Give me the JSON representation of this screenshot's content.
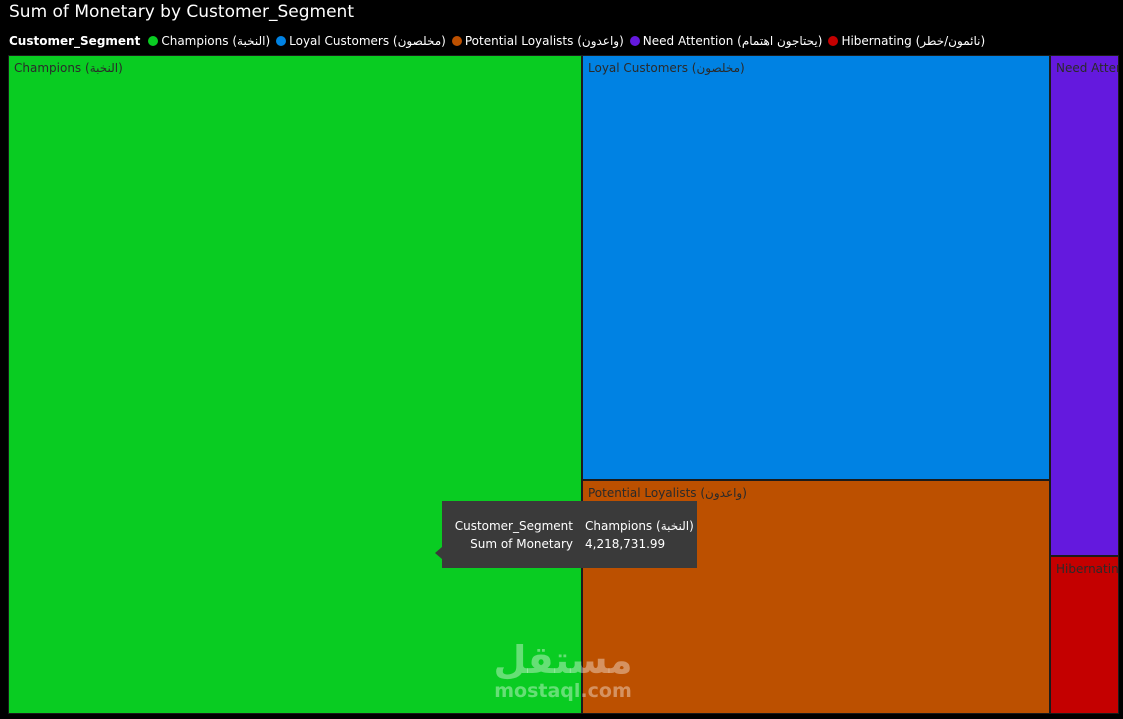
{
  "chart_data": {
    "type": "treemap",
    "title": "Sum of Monetary by Customer_Segment",
    "legend_title": "Customer_Segment",
    "legend_position": "top-left",
    "categories": [
      "Champions (النخبة)",
      "Loyal Customers (مخلصون)",
      "Potential Loyalists (واعدون)",
      "Need Attention (يحتاجون اهتمام)",
      "Hibernating (نائمون/خطر)"
    ],
    "values": [
      4218731.99,
      2220000,
      1220000,
      380000,
      120000
    ],
    "colors": [
      "#09cc22",
      "#0082e3",
      "#bc5000",
      "#6419de",
      "#c40000"
    ],
    "tile_labels": [
      "Champions (النخبة)",
      "Loyal Customers (مخلصون)",
      "Potential Loyalists (واعدون)",
      "Need Attention (يحتاجون اهتمام)",
      "Hibernating (نائمون/خطر)"
    ]
  },
  "tooltip": {
    "segment_key": "Customer_Segment",
    "segment_value": "Champions (النخبة)",
    "metric_key": "Sum of Monetary",
    "metric_value": "4,218,731.99"
  },
  "watermark": {
    "arabic": "مستقل",
    "latin": "mostaql.com"
  }
}
